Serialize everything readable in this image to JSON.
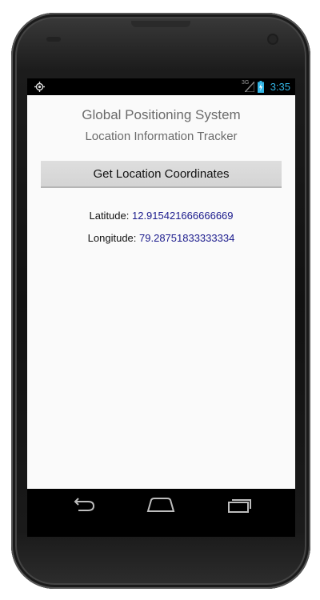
{
  "status_bar": {
    "time": "3:35",
    "network": "3G",
    "icons": [
      "gps-icon",
      "signal-icon",
      "battery-icon"
    ]
  },
  "app": {
    "title": "Global Positioning System",
    "subtitle": "Location Information Tracker",
    "button_label": "Get Location Coordinates",
    "latitude_label": "Latitude: ",
    "latitude_value": "12.915421666666669",
    "longitude_label": "Longitude: ",
    "longitude_value": "79.28751833333334"
  },
  "nav_bar": {
    "icons": [
      "back-icon",
      "home-icon",
      "recent-apps-icon"
    ]
  },
  "colors": {
    "accent": "#33b5e5",
    "value_text": "#1a1a8c",
    "title_text": "#6b6b6b",
    "screen_bg": "#fafafa"
  }
}
